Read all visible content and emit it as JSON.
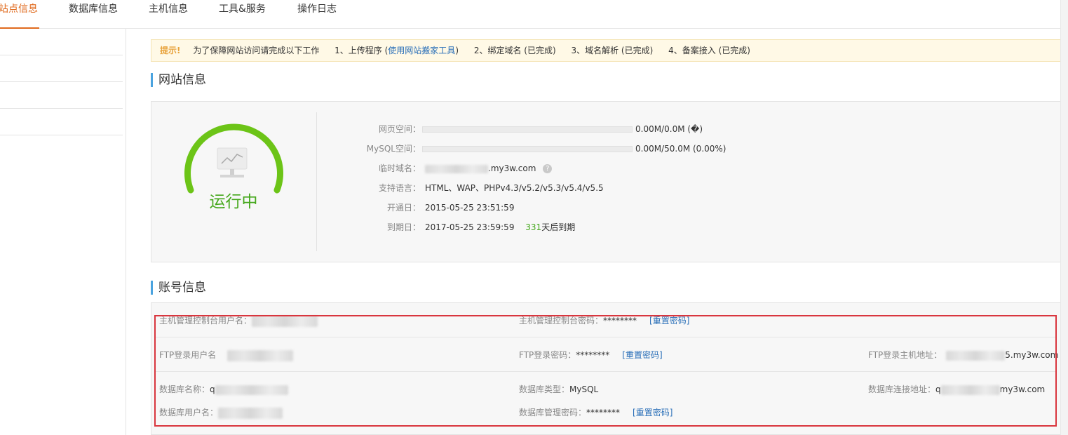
{
  "tabs": [
    {
      "label": "站点信息",
      "active": true
    },
    {
      "label": "数据库信息",
      "active": false
    },
    {
      "label": "主机信息",
      "active": false
    },
    {
      "label": "工具&服务",
      "active": false
    },
    {
      "label": "操作日志",
      "active": false
    }
  ],
  "notice": {
    "tip": "提示!",
    "intro": "为了保障网站访问请完成以下工作",
    "step1_prefix": "1、上传程序 (",
    "step1_link": "使用网站搬家工具",
    "step1_suffix": ")",
    "step2": "2、绑定域名 (已完成)",
    "step3": "3、域名解析 (已完成)",
    "step4": "4、备案接入 (已完成)"
  },
  "site_section": {
    "title": "网站信息",
    "status": "运行中",
    "rows": {
      "web_space": {
        "label": "网页空间：",
        "value": "0.00M/0.0M (�)",
        "usage_fraction": 0
      },
      "mysql_space": {
        "label": "MySQL空间：",
        "value": "0.00M/50.0M (0.00%)",
        "usage_fraction": 0
      },
      "temp_domain": {
        "label": "临时域名：",
        "value": ".my3w.com"
      },
      "languages": {
        "label": "支持语言：",
        "value": "HTML、WAP、PHPv4.3/v5.2/v5.3/v5.4/v5.5"
      },
      "open_date": {
        "label": "开通日：",
        "value": "2015-05-25 23:51:59"
      },
      "expire_date": {
        "label": "到期日：",
        "value": "2017-05-25 23:59:59",
        "days_left": "331",
        "days_suffix": "天后到期"
      }
    }
  },
  "account_section": {
    "title": "账号信息",
    "console_user_label": "主机管理控制台用户名：",
    "console_pwd_label": "主机管理控制台密码：",
    "console_pwd_value": "********",
    "reset_label": "[重置密码]",
    "ftp_user_label": "FTP登录用户名",
    "ftp_pwd_label": "FTP登录密码：",
    "ftp_pwd_value": "********",
    "ftp_host_label": "FTP登录主机地址：",
    "ftp_host_value": "5.my3w.com",
    "db_name_label": "数据库名称：",
    "db_name_prefix": "q",
    "db_type_label": "数据库类型：",
    "db_type_value": "MySQL",
    "db_host_label": "数据库连接地址：",
    "db_host_prefix": "q",
    "db_host_suffix": "my3w.com",
    "db_user_label": "数据库用户名：",
    "db_pwd_label": "数据库管理密码：",
    "db_pwd_value": "********"
  },
  "colors": {
    "accent": "#e06a1d",
    "running": "#45a81c",
    "link": "#2a6fb8",
    "highlight_box": "#d9363e"
  }
}
